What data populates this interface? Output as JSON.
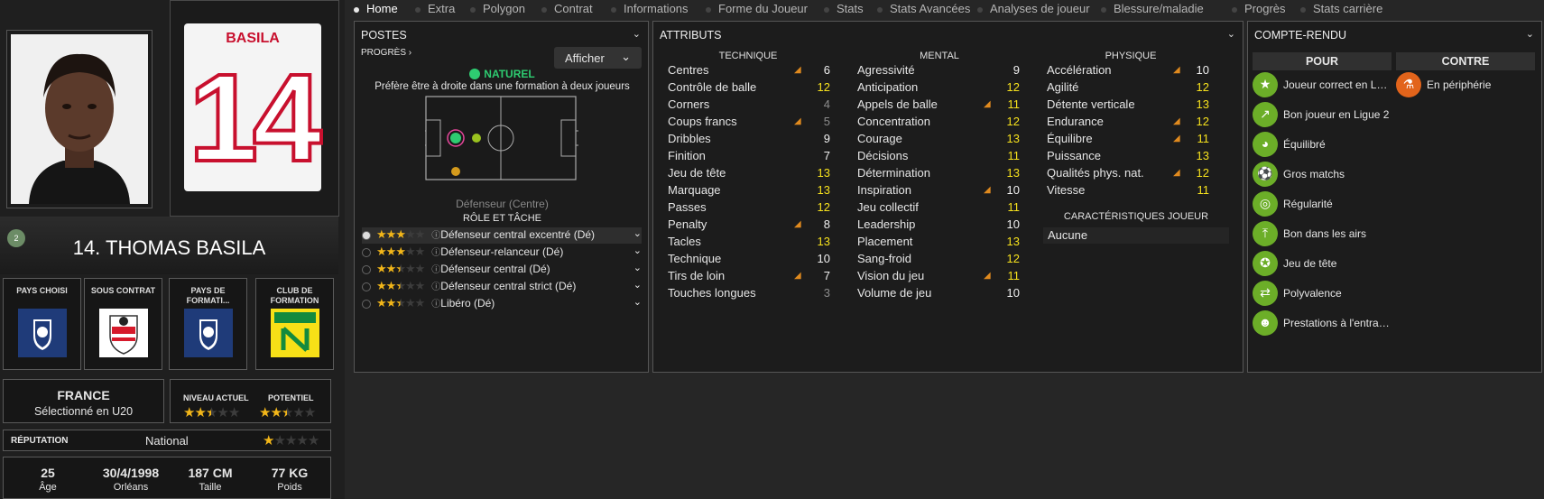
{
  "tabs": [
    {
      "label": "Home",
      "active": true
    },
    {
      "label": "Extra"
    },
    {
      "label": "Polygon"
    },
    {
      "label": "Contrat"
    },
    {
      "label": "Informations"
    },
    {
      "label": "Forme du Joueur"
    },
    {
      "label": "Stats"
    },
    {
      "label": "Stats Avancées"
    },
    {
      "label": "Analyses de joueur"
    },
    {
      "label": "Blessure/maladie"
    },
    {
      "label": "Progrès"
    },
    {
      "label": "Stats carrière"
    }
  ],
  "player": {
    "shirt_name": "BASILA",
    "shirt_number": "14",
    "full_name": "14. THOMAS BASILA",
    "badge": "2",
    "country": "FRANCE",
    "selection": "Sélectionné en U20",
    "current_level_label": "NIVEAU ACTUEL",
    "current_level_stars": 2.5,
    "potential_label": "POTENTIEL",
    "potential_stars": 2.5,
    "reputation_label": "RÉPUTATION",
    "reputation": "National",
    "reputation_stars": 1,
    "age": "25",
    "age_label": "Âge",
    "dob": "30/4/1998",
    "birthplace": "Orléans",
    "height": "187 CM",
    "height_label": "Taille",
    "weight": "77 KG",
    "weight_label": "Poids"
  },
  "flags": [
    {
      "label": "PAYS CHOISI",
      "icon": "france-fff-crest"
    },
    {
      "label": "SOUS CONTRAT",
      "icon": "ac-ajaccio-crest"
    },
    {
      "label": "PAYS DE FORMATI...",
      "icon": "france-fff-crest"
    },
    {
      "label": "CLUB DE FORMATION",
      "icon": "fc-nantes-crest"
    }
  ],
  "postes": {
    "title": "POSTES",
    "progress": "PROGRÈS",
    "show_button": "Afficher",
    "natural": "NATUREL",
    "preference": "Préfère être à droite dans une formation à deux joueurs",
    "position": "Défenseur (Centre)",
    "role_header": "RÔLE ET TÂCHE",
    "roles": [
      {
        "label": "Défenseur central excentré (Dé)",
        "stars": 3,
        "selected": true
      },
      {
        "label": "Défenseur-relanceur (Dé)",
        "stars": 3
      },
      {
        "label": "Défenseur central (Dé)",
        "stars": 2.5
      },
      {
        "label": "Défenseur central strict (Dé)",
        "stars": 2.5
      },
      {
        "label": "Libéro (Dé)",
        "stars": 2.5
      }
    ]
  },
  "attributes": {
    "title": "ATTRIBUTS",
    "technique_header": "TECHNIQUE",
    "mental_header": "MENTAL",
    "physique_header": "PHYSIQUE",
    "technique": [
      {
        "name": "Centres",
        "value": "6",
        "color": "w",
        "arrow": true
      },
      {
        "name": "Contrôle de balle",
        "value": "12",
        "color": "y"
      },
      {
        "name": "Corners",
        "value": "4",
        "color": "g"
      },
      {
        "name": "Coups francs",
        "value": "5",
        "color": "g",
        "arrow": true
      },
      {
        "name": "Dribbles",
        "value": "9",
        "color": "w"
      },
      {
        "name": "Finition",
        "value": "7",
        "color": "w"
      },
      {
        "name": "Jeu de tête",
        "value": "13",
        "color": "y"
      },
      {
        "name": "Marquage",
        "value": "13",
        "color": "y"
      },
      {
        "name": "Passes",
        "value": "12",
        "color": "y"
      },
      {
        "name": "Penalty",
        "value": "8",
        "color": "w",
        "arrow": true
      },
      {
        "name": "Tacles",
        "value": "13",
        "color": "y"
      },
      {
        "name": "Technique",
        "value": "10",
        "color": "w"
      },
      {
        "name": "Tirs de loin",
        "value": "7",
        "color": "w",
        "arrow": true
      },
      {
        "name": "Touches longues",
        "value": "3",
        "color": "g"
      }
    ],
    "mental": [
      {
        "name": "Agressivité",
        "value": "9",
        "color": "w"
      },
      {
        "name": "Anticipation",
        "value": "12",
        "color": "y"
      },
      {
        "name": "Appels de balle",
        "value": "11",
        "color": "y",
        "arrow": true
      },
      {
        "name": "Concentration",
        "value": "12",
        "color": "y"
      },
      {
        "name": "Courage",
        "value": "13",
        "color": "y"
      },
      {
        "name": "Décisions",
        "value": "11",
        "color": "y"
      },
      {
        "name": "Détermination",
        "value": "13",
        "color": "y"
      },
      {
        "name": "Inspiration",
        "value": "10",
        "color": "w",
        "arrow": true
      },
      {
        "name": "Jeu collectif",
        "value": "11",
        "color": "y"
      },
      {
        "name": "Leadership",
        "value": "10",
        "color": "w"
      },
      {
        "name": "Placement",
        "value": "13",
        "color": "y"
      },
      {
        "name": "Sang-froid",
        "value": "12",
        "color": "y"
      },
      {
        "name": "Vision du jeu",
        "value": "11",
        "color": "y",
        "arrow": true
      },
      {
        "name": "Volume de jeu",
        "value": "10",
        "color": "w"
      }
    ],
    "physique": [
      {
        "name": "Accélération",
        "value": "10",
        "color": "w",
        "arrow": true
      },
      {
        "name": "Agilité",
        "value": "12",
        "color": "y"
      },
      {
        "name": "Détente verticale",
        "value": "13",
        "color": "y"
      },
      {
        "name": "Endurance",
        "value": "12",
        "color": "y",
        "arrow": true
      },
      {
        "name": "Équilibre",
        "value": "11",
        "color": "y",
        "arrow": true
      },
      {
        "name": "Puissance",
        "value": "13",
        "color": "y"
      },
      {
        "name": "Qualités phys. nat.",
        "value": "12",
        "color": "y",
        "arrow": true
      },
      {
        "name": "Vitesse",
        "value": "11",
        "color": "y"
      }
    ],
    "characteristics_header": "CARACTÉRISTIQUES JOUEUR",
    "characteristics": "Aucune"
  },
  "report": {
    "title": "COMPTE-RENDU",
    "pros_header": "POUR",
    "cons_header": "CONTRE",
    "pros": [
      {
        "label": "Joueur correct en Lig...",
        "icon": "star-icon"
      },
      {
        "label": "Bon joueur en Ligue 2",
        "icon": "trend-up-icon"
      },
      {
        "label": "Équilibré",
        "icon": "head-icon"
      },
      {
        "label": "Gros matchs",
        "icon": "ball-icon"
      },
      {
        "label": "Régularité",
        "icon": "target-icon"
      },
      {
        "label": "Bon dans les airs",
        "icon": "leap-icon"
      },
      {
        "label": "Jeu de tête",
        "icon": "header-icon"
      },
      {
        "label": "Polyvalence",
        "icon": "handshake-icon"
      },
      {
        "label": "Prestations à l'entraîn...",
        "icon": "training-icon"
      }
    ],
    "cons": [
      {
        "label": "En périphérie",
        "icon": "flask-icon"
      }
    ]
  },
  "colors": {
    "accent_yellow": "#f6e11d",
    "pro_green": "#6cae28",
    "con_orange": "#e2641b",
    "star": "#f2b619",
    "natural_green": "#2ecc71"
  }
}
